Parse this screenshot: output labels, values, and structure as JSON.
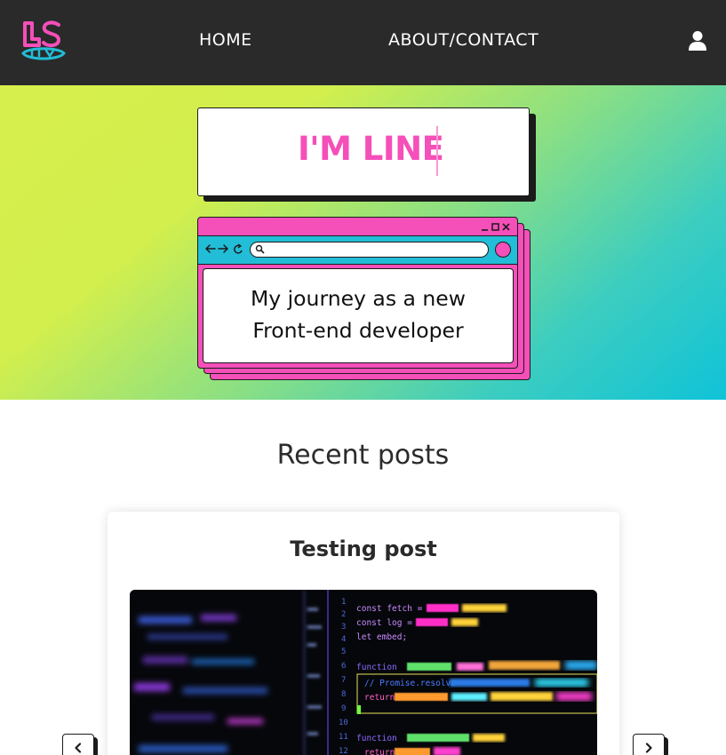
{
  "nav": {
    "logo_alt": "LS dev logo",
    "home_label": "HOME",
    "about_label": "ABOUT/CONTACT"
  },
  "hero": {
    "title": "I'M LINE",
    "tagline_line1": "My journey as a new",
    "tagline_line2": "Front-end developer"
  },
  "recent": {
    "heading": "Recent posts",
    "posts": [
      {
        "title": "Testing post"
      }
    ]
  },
  "colors": {
    "nav_bg": "#2a2a2a",
    "accent_pink": "#f54fb9",
    "accent_cyan": "#22bdd7",
    "hero_gradient_start": "#d7ef4c",
    "hero_gradient_end": "#0fc3d8"
  },
  "icons": {
    "user": "user-icon",
    "logo": "logo-icon",
    "prev": "chevron-left-icon",
    "next": "chevron-right-icon"
  }
}
